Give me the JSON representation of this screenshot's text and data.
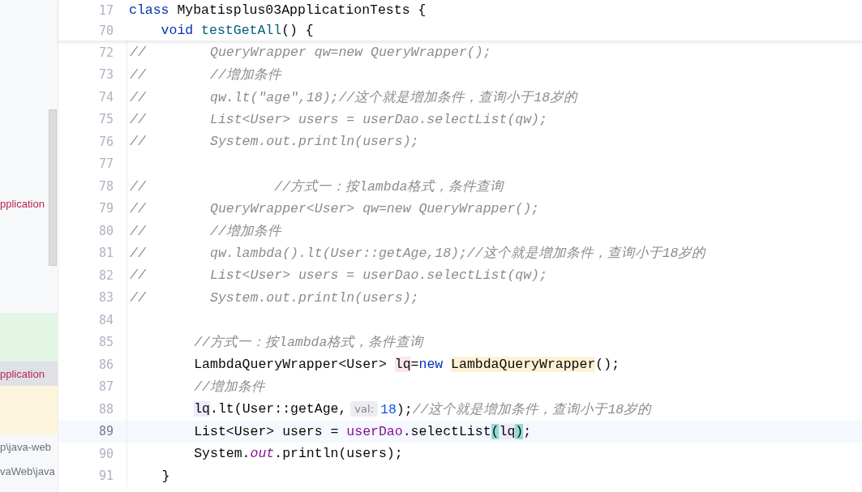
{
  "project_panel": {
    "items": [
      {
        "text": "pplication",
        "error": true,
        "selected": false
      },
      {
        "color": "#e3f5e5"
      },
      {
        "text": "pplication",
        "error": true,
        "selected": true
      },
      {
        "color": "#fdf5dc"
      },
      {
        "text": "p\\java-web",
        "error": false,
        "selected": false
      },
      {
        "text": "vaWeb\\java",
        "error": false,
        "selected": false
      }
    ]
  },
  "editor": {
    "sticky_lines": [
      {
        "number": "17",
        "tokens": [
          {
            "text": "class",
            "kind": "keyword"
          },
          {
            "text": " Mybatisplus03ApplicationTests {",
            "kind": "plain"
          }
        ]
      },
      {
        "number": "70",
        "tokens": [
          {
            "text": "    void",
            "kind": "keyword"
          },
          {
            "text": " testGetAll",
            "kind": "method-decl"
          },
          {
            "text": "() {",
            "kind": "plain"
          }
        ]
      }
    ],
    "lines": [
      {
        "number": "72",
        "current": false,
        "tokens": [
          {
            "text": "//        QueryWrapper qw=new QueryWrapper();",
            "kind": "comment"
          }
        ]
      },
      {
        "number": "73",
        "current": false,
        "tokens": [
          {
            "text": "//        //增加条件",
            "kind": "comment"
          }
        ]
      },
      {
        "number": "74",
        "current": false,
        "tokens": [
          {
            "text": "//        qw.lt(\"age\",18);//这个就是增加条件，查询小于18岁的",
            "kind": "comment"
          }
        ]
      },
      {
        "number": "75",
        "current": false,
        "tokens": [
          {
            "text": "//        List<User> users = userDao.selectList(qw);",
            "kind": "comment"
          }
        ]
      },
      {
        "number": "76",
        "current": false,
        "tokens": [
          {
            "text": "//        System.out.println(users);",
            "kind": "comment"
          }
        ]
      },
      {
        "number": "77",
        "current": false
      },
      {
        "number": "78",
        "current": false,
        "tokens": [
          {
            "text": "//                //方式一：按lambda格式，条件查询",
            "kind": "comment"
          }
        ]
      },
      {
        "number": "79",
        "current": false,
        "tokens": [
          {
            "text": "//        QueryWrapper<User> qw=new QueryWrapper();",
            "kind": "comment"
          }
        ]
      },
      {
        "number": "80",
        "current": false,
        "tokens": [
          {
            "text": "//        //增加条件",
            "kind": "comment"
          }
        ]
      },
      {
        "number": "81",
        "current": false,
        "tokens": [
          {
            "text": "//        qw.lambda().lt(User::getAge,18);//这个就是增加条件，查询小于18岁的",
            "kind": "comment"
          }
        ]
      },
      {
        "number": "82",
        "current": false,
        "tokens": [
          {
            "text": "//        List<User> users = userDao.selectList(qw);",
            "kind": "comment"
          }
        ]
      },
      {
        "number": "83",
        "current": false,
        "tokens": [
          {
            "text": "//        System.out.println(users);",
            "kind": "comment"
          }
        ]
      },
      {
        "number": "84",
        "current": false
      },
      {
        "number": "85",
        "current": false,
        "tokens": [
          {
            "text": "        //方式一：按lambda格式，条件查询",
            "kind": "comment"
          }
        ]
      },
      {
        "number": "86",
        "current": false,
        "tokens": [
          {
            "text": "        LambdaQueryWrapper<User> ",
            "kind": "plain"
          },
          {
            "text": "lq",
            "kind": "plain",
            "color": "#fbe5ef"
          },
          {
            "text": "=",
            "kind": "plain"
          },
          {
            "text": "new ",
            "kind": "keyword"
          },
          {
            "text": "LambdaQueryWrapper",
            "kind": "plain",
            "color": "#fcf2d4"
          },
          {
            "text": "();",
            "kind": "plain"
          }
        ]
      },
      {
        "number": "87",
        "current": false,
        "tokens": [
          {
            "text": "        //增加条件",
            "kind": "comment"
          }
        ]
      },
      {
        "number": "88",
        "current": false,
        "tokens": [
          {
            "text": "        lq",
            "kind": "plain",
            "color": "#ecebfa"
          },
          {
            "text": ".lt(User::getAge,",
            "kind": "plain"
          },
          {
            "text": "val:",
            "kind": "hint"
          },
          {
            "text": "18",
            "kind": "number"
          },
          {
            "text": ");",
            "kind": "plain"
          },
          {
            "text": "//这个就是增加条件，查询小于18岁的",
            "kind": "comment"
          }
        ]
      },
      {
        "number": "89",
        "current": true,
        "tokens": [
          {
            "text": "        List<User> users = ",
            "kind": "plain"
          },
          {
            "text": "userDao",
            "kind": "field"
          },
          {
            "text": ".selectList",
            "kind": "plain"
          },
          {
            "text": "(",
            "kind": "plain",
            "color": "#93d9d9"
          },
          {
            "text": "lq",
            "kind": "plain",
            "color": "#ecebfa"
          },
          {
            "text": ")",
            "kind": "plain",
            "color": "#93d9d9"
          },
          {
            "text": ";",
            "kind": "plain"
          }
        ]
      },
      {
        "number": "90",
        "current": false,
        "tokens": [
          {
            "text": "        System.",
            "kind": "plain"
          },
          {
            "text": "out",
            "kind": "static-field"
          },
          {
            "text": ".println(users);",
            "kind": "plain"
          }
        ]
      },
      {
        "number": "91",
        "current": false,
        "tokens": [
          {
            "text": "    }",
            "kind": "plain"
          }
        ]
      }
    ]
  }
}
